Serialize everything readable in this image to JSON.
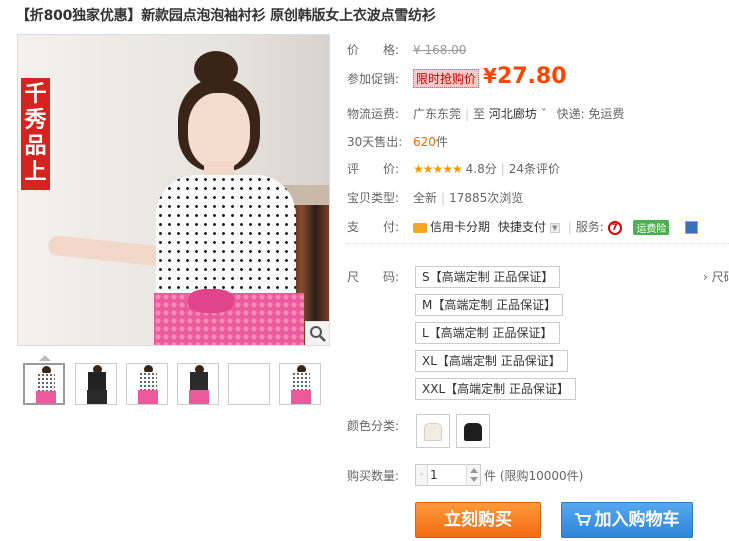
{
  "title": "【折800独家优惠】新款园点泡泡袖衬衫 原创韩版女上衣波点雪纺衫",
  "image": {
    "badge": "千秀品上"
  },
  "info": {
    "price_label": "价　　格:",
    "price_original": "¥ 168.00",
    "promo_label": "参加促销:",
    "promo_tag": "限时抢购价",
    "promo_currency": "¥",
    "promo_price": "27.80",
    "shipping_label": "物流运费:",
    "shipping_from": "广东东莞",
    "shipping_to_sep": "至",
    "shipping_to": "河北廊坊",
    "shipping_fee": "快递: 免运费",
    "sold_label": "30天售出:",
    "sold_count": "620",
    "sold_unit": "件",
    "rating_label": "评　　价:",
    "rating_stars": "★★★★★",
    "rating_score": "4.8分",
    "rating_reviews": "24条评价",
    "type_label": "宝贝类型:",
    "type_value": "全新",
    "type_views": "17885次浏览",
    "pay_label": "支　　付:",
    "pay_credit": "信用卡分期",
    "pay_quick": "快捷支付",
    "service_label": "服务:",
    "service_badge": "运费险"
  },
  "sizes": {
    "label": "尺　　码:",
    "more": "› 尺码",
    "options": [
      "S【高端定制 正品保证】",
      "M【高端定制 正品保证】",
      "L【高端定制 正品保证】",
      "XL【高端定制 正品保证】",
      "XXL【高端定制 正品保证】"
    ]
  },
  "colors": {
    "label": "颜色分类:",
    "swatch_colors": [
      "#f2ece4",
      "#1e1e1e"
    ]
  },
  "quantity": {
    "label": "购买数量:",
    "value": "1",
    "unit": "件 (限购10000件)"
  },
  "buttons": {
    "buy_now": "立刻购买",
    "add_cart": "加入购物车"
  },
  "colors_theme": {
    "price": "#ff4400",
    "buy": "#f26b12",
    "cart": "#2f86d8"
  }
}
